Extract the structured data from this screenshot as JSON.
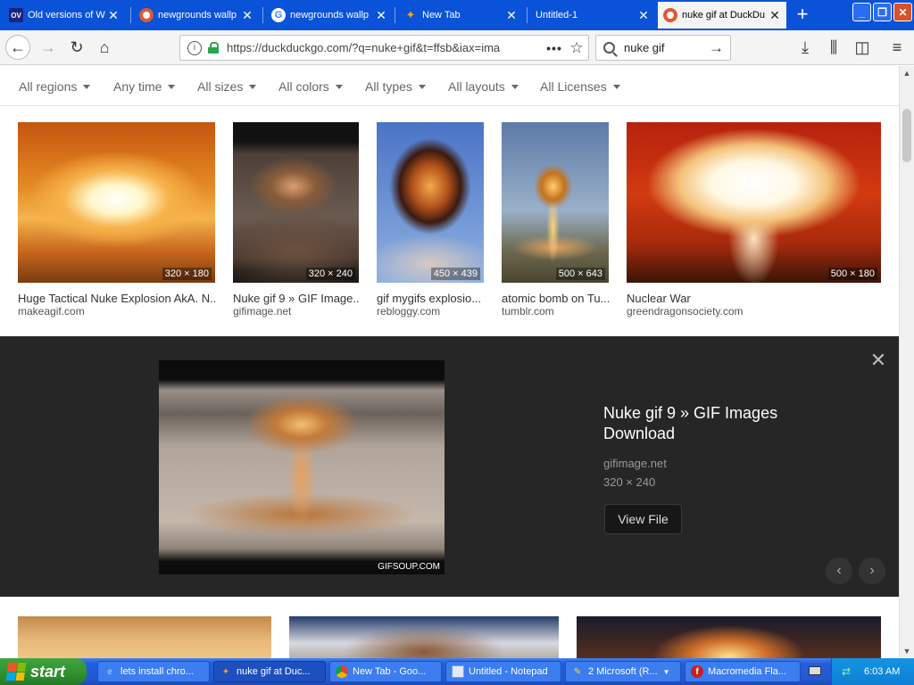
{
  "browser": {
    "tabs": [
      {
        "title": "Old versions of W",
        "icon": "ov"
      },
      {
        "title": "newgrounds wallp",
        "icon": "duckduckgo"
      },
      {
        "title": "newgrounds wallp",
        "icon": "google"
      },
      {
        "title": "New Tab",
        "icon": "newgrounds"
      },
      {
        "title": "Untitled-1",
        "icon": "none"
      },
      {
        "title": "nuke gif at DuckDu",
        "icon": "duckduckgo"
      }
    ],
    "url": "https://duckduckgo.com/?q=nuke+gif&t=ffsb&iax=ima",
    "search_query": "nuke gif"
  },
  "filters": [
    "All regions",
    "Any time",
    "All sizes",
    "All colors",
    "All types",
    "All layouts",
    "All Licenses"
  ],
  "results": [
    {
      "title": "Huge Tactical Nuke Explosion AkA. N...",
      "source": "makeagif.com",
      "dims": "320 × 180"
    },
    {
      "title": "Nuke gif 9 » GIF Image...",
      "source": "gifimage.net",
      "dims": "320 × 240"
    },
    {
      "title": "gif mygifs explosio...",
      "source": "rebloggy.com",
      "dims": "450 × 439"
    },
    {
      "title": "atomic bomb on Tu...",
      "source": "tumblr.com",
      "dims": "500 × 643"
    },
    {
      "title": "Nuclear War",
      "source": "greendragonsociety.com",
      "dims": "500 × 180"
    }
  ],
  "detail": {
    "title": "Nuke gif 9 » GIF Images Download",
    "source": "gifimage.net",
    "dims": "320 × 240",
    "button": "View File",
    "watermark": "GIFSOUP.COM"
  },
  "taskbar": {
    "start": "start",
    "items": [
      {
        "label": "lets install chro...",
        "icon": "ie"
      },
      {
        "label": "nuke gif at Duc...",
        "icon": "firefox"
      },
      {
        "label": "New Tab - Goo...",
        "icon": "chrome"
      },
      {
        "label": "Untitled - Notepad",
        "icon": "notepad"
      },
      {
        "label": "2 Microsoft (R...",
        "icon": "paint"
      },
      {
        "label": "Macromedia Fla...",
        "icon": "flash"
      }
    ],
    "clock": "6:03 AM"
  },
  "colors": {
    "tabbar": "#0a53d8",
    "detail_bg": "#262626",
    "taskbar": "#2457d0",
    "start": "#2f8f2f"
  }
}
